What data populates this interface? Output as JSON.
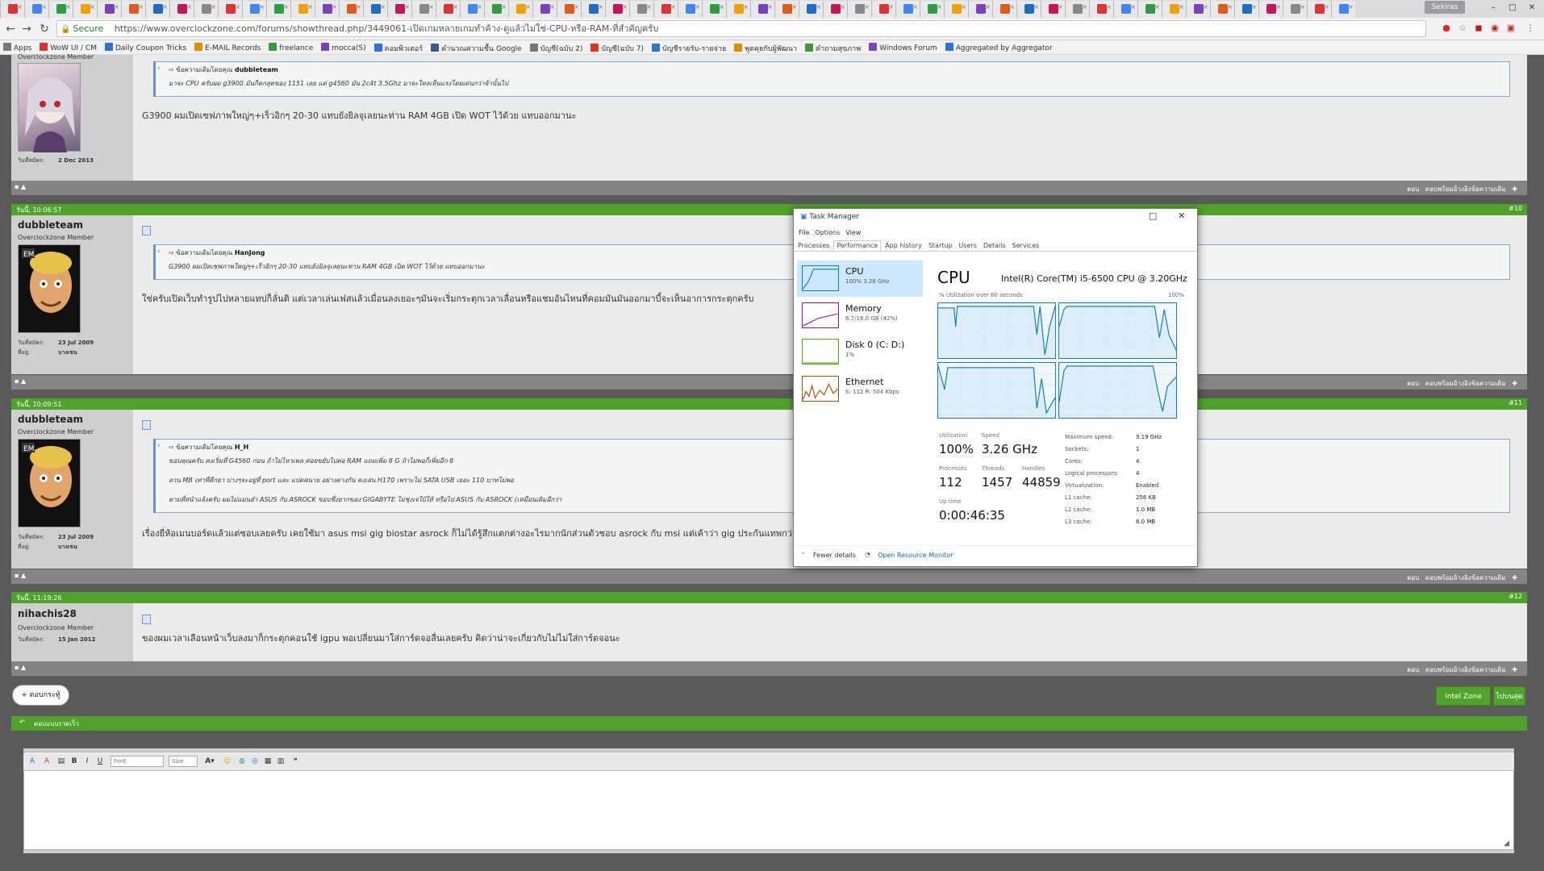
{
  "browser": {
    "user_chip": "Sekiras",
    "secure_label": "Secure",
    "url": "https://www.overclockzone.com/forums/showthread.php/3449061-เปิดเกมหลายเกมทำค้าง-ดูแล้วไม่ใช่-CPU-หรือ-RAM-ที่สำคัญครับ",
    "bookmarks": [
      "Apps",
      "WoW UI / CM",
      "Daily Coupon Tricks",
      "E-MAIL Records",
      "freelance",
      "mocca(S)",
      "คอมพิวเตอร์",
      "คำนวณความชื้น Google",
      "บัญชี(ฉบับ 2)",
      "บัญชี(ฉบับ 7)",
      "บัญชีรายรับ-รายจ่าย",
      "พูดคุยกับผู้พัฒนา",
      "คำถามสุขภาพ",
      "Windows Forum",
      "Aggregated by Aggregator"
    ]
  },
  "posts": [
    {
      "rank": "Overclockzone Member",
      "joined_label": "วันที่สมัคร:",
      "joined": "2 Dec 2013",
      "quote_head": "ข้อความเดิมโดยคุณ",
      "quote_user": "dubbleteam",
      "quote_lines": [
        "มาจะ CPU ครับผม g3900 มันก็ตกสุดของ 1151 เลย แต่ g4560 มัน 2c4t 3.5Ghz มาจะใหลเห็นแรงโดยเด่นกว่าจ้านั้นไป"
      ],
      "text": "G3900 ผมเปิดเซฟภาพใหญ่ๆ+เร็วอิกๆ 20-30 แทบยังยิลจุเลยนะท่าน RAM 4GB เปิด WOT ไว้ด้วย แทบออกมานะ"
    },
    {
      "header_left": "วันนี้, 10:06:57",
      "header_right": "#10",
      "username": "dubbleteam",
      "rank": "Overclockzone Member",
      "joined_label": "วันที่สมัคร:",
      "joined": "23 Jul 2009",
      "loc_label": "ที่อยู่:",
      "loc": "บางเขน",
      "quote_head": "ข้อความเดิมโดยคุณ",
      "quote_user": "HanJong",
      "quote_lines": [
        "G3900 ผมเปิดเซฟภาพใหญ่ๆ+เร็วอิกๆ 20-30 แทบยังยิลจุเลยนะท่าน RAM 4GB เปิด WOT ไว้ด้วย แทบออกมานะ"
      ],
      "text": "ใช่ครับเปิดเว็บทำรูปไปหลายแทปก็ลั่นติ แต่เวลาเล่นเฟสแล้วเมื่อนลงเยอะๆมันจะเริ่มกระตุกเวลาเลื่อนหรือแชมอันไหนที่คอมมันมันออกมาบี้จะเห็นอาการกระตุกครับ"
    },
    {
      "header_left": "วันนี้, 10:09:51",
      "header_right": "#11",
      "username": "dubbleteam",
      "rank": "Overclockzone Member",
      "joined_label": "วันที่สมัคร:",
      "joined": "23 Jul 2009",
      "loc_label": "ที่อยู่:",
      "loc": "บางเขน",
      "quote_head": "ข้อความเดิมโดยคุณ",
      "quote_user": "H_H",
      "quote_lines": [
        "ขอบคุณครับ คงเริ่มที่ G4560 ก่อน ถ้าไม่ไหวเพล ค่อยขยับไปต่อ RAM แถมเพิ่ม 8 G ถ้าไม่พอก็เพิ่มอีก 8",
        "ลวน MB เท่าที่ดีกยา บ่างๆจะอยู่ที่ port และ แปดคนาย อย่างต่างกัน คงเล่น H170 เพราะไม่ SATA USB เยอะ 110 บาทไม่พอ",
        "ตามที่สนำแจ้งครับ ผมไม่แม่นยำ ASUS กับ ASROCK ขอบซึ่งยากของ GIGABYTE ไม่ชุ่งเจใบ้ให้ หรือไป ASUS กับ ASROCK (เหมือนเดิมอีกว่า"
      ],
      "text": "เรื่องยี่ห้อเมนบอร์ดแล้วแต่ชอบเลยครับ เคยใช้มา asus msi gig biostar asrock ก็ไม่ได้รู้สึกแตกต่างอะไรมากนักส่วนตัวชอบ asrock กับ msi แต่เค้าว่า gig ประกันแทพกว่าอีกครับ"
    },
    {
      "header_left": "วันนี้, 11:19:26",
      "header_right": "#12",
      "username": "nihachis28",
      "rank": "Overclockzone Member",
      "joined_label": "วันที่สมัคร:",
      "joined": "15 Jan 2012",
      "text": "ของผมเวลาเลือนหน้าเว็บลงมาก็กระตุกคอนใช้ igpu พอเปลี่ยนมาใส่การ์ดจอลื่นเลยครับ คิดว่าน่าจะเกี่ยวกับไม่ไม่ใส่การ์ดจอนะ"
    }
  ],
  "post_footer": {
    "reply": "ตอบ",
    "reply_quote": "ตอบพร้อมอ้างอิงข้อความเดิม"
  },
  "actions": {
    "reply_thread": "+ ตอบกระทู้",
    "intel_zone": "Intel Zone",
    "go_to": "ไปบนสุด"
  },
  "quick_reply": {
    "title": "ตอบแบบรวดเร็ว",
    "font_placeholder": "Font",
    "size_placeholder": "Size"
  },
  "taskmgr": {
    "title": "Task Manager",
    "menu": [
      "File",
      "Options",
      "View"
    ],
    "tabs": [
      "Processes",
      "Performance",
      "App history",
      "Startup",
      "Users",
      "Details",
      "Services"
    ],
    "resources": [
      {
        "name": "CPU",
        "sub": "100% 3.26 GHz",
        "color": "#117dbb"
      },
      {
        "name": "Memory",
        "sub": "6.7/16.0 GB (42%)",
        "color": "#8b12ae"
      },
      {
        "name": "Disk 0 (C: D:)",
        "sub": "1%",
        "color": "#4da60c"
      },
      {
        "name": "Ethernet",
        "sub": "S: 112 R: 504 Kbps",
        "color": "#a74f01"
      }
    ],
    "cpu_title": "CPU",
    "cpu_model": "Intel(R) Core(TM) i5-6500 CPU @ 3.20GHz",
    "util_caption": "% Utilization over 60 seconds",
    "util_max": "100%",
    "stats": {
      "utilization_label": "Utilization",
      "utilization": "100%",
      "speed_label": "Speed",
      "speed": "3.26 GHz",
      "processes_label": "Processes",
      "processes": "112",
      "threads_label": "Threads",
      "threads": "1457",
      "handles_label": "Handles",
      "handles": "44859",
      "uptime_label": "Up time",
      "uptime": "0:00:46:35"
    },
    "specs": [
      {
        "k": "Maximum speed:",
        "v": "3.19 GHz"
      },
      {
        "k": "Sockets:",
        "v": "1"
      },
      {
        "k": "Cores:",
        "v": "4"
      },
      {
        "k": "Logical processors:",
        "v": "4"
      },
      {
        "k": "Virtualization:",
        "v": "Enabled"
      },
      {
        "k": "L1 cache:",
        "v": "256 KB"
      },
      {
        "k": "L2 cache:",
        "v": "1.0 MB"
      },
      {
        "k": "L3 cache:",
        "v": "6.0 MB"
      }
    ],
    "fewer_details": "Fewer details",
    "open_monitor": "Open Resource Monitor"
  },
  "colors": {
    "forum_green": "#4fa32b",
    "cpu_blue": "#117dbb",
    "page_dark": "#5a5a5a"
  }
}
